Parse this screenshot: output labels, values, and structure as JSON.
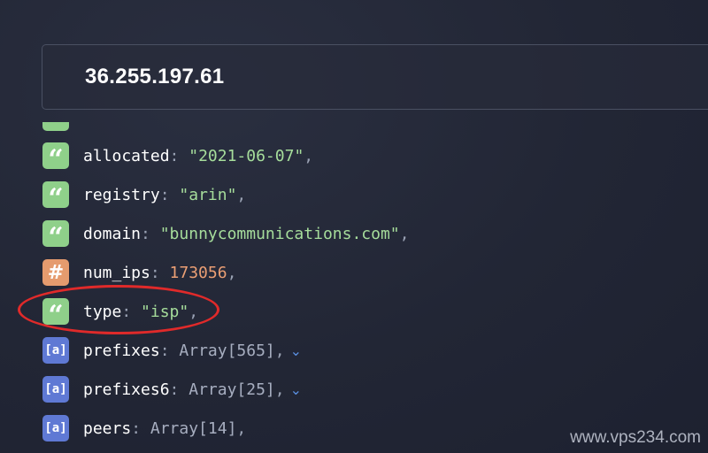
{
  "search": {
    "ip": "36.255.197.61"
  },
  "fields": [
    {
      "key": "allocated",
      "value": "\"2021-06-07\"",
      "type": "string",
      "icon": "quote-icon"
    },
    {
      "key": "registry",
      "value": "\"arin\"",
      "type": "string",
      "icon": "quote-icon"
    },
    {
      "key": "domain",
      "value": "\"bunnycommunications.com\"",
      "type": "string",
      "icon": "quote-icon"
    },
    {
      "key": "num_ips",
      "value": "173056",
      "type": "number",
      "icon": "hash-icon"
    },
    {
      "key": "type",
      "value": "\"isp\"",
      "type": "string",
      "icon": "quote-icon"
    },
    {
      "key": "prefixes",
      "value": "Array[565]",
      "type": "array",
      "icon": "array-icon",
      "expandable": true
    },
    {
      "key": "prefixes6",
      "value": "Array[25]",
      "type": "array",
      "icon": "array-icon",
      "expandable": true
    },
    {
      "key": "peers",
      "value": "Array[14]",
      "type": "array",
      "icon": "array-icon"
    }
  ],
  "badges": {
    "string": "“",
    "number": "#",
    "array": "[a]"
  },
  "punctuation": {
    "colon": ":",
    "comma": ",",
    "chevron": "⌄"
  },
  "colors": {
    "string_badge": "#8fd08a",
    "number_badge": "#e59b6e",
    "array_badge": "#5f79d4",
    "highlight": "#e02a2a"
  },
  "watermark": "www.vps234.com"
}
